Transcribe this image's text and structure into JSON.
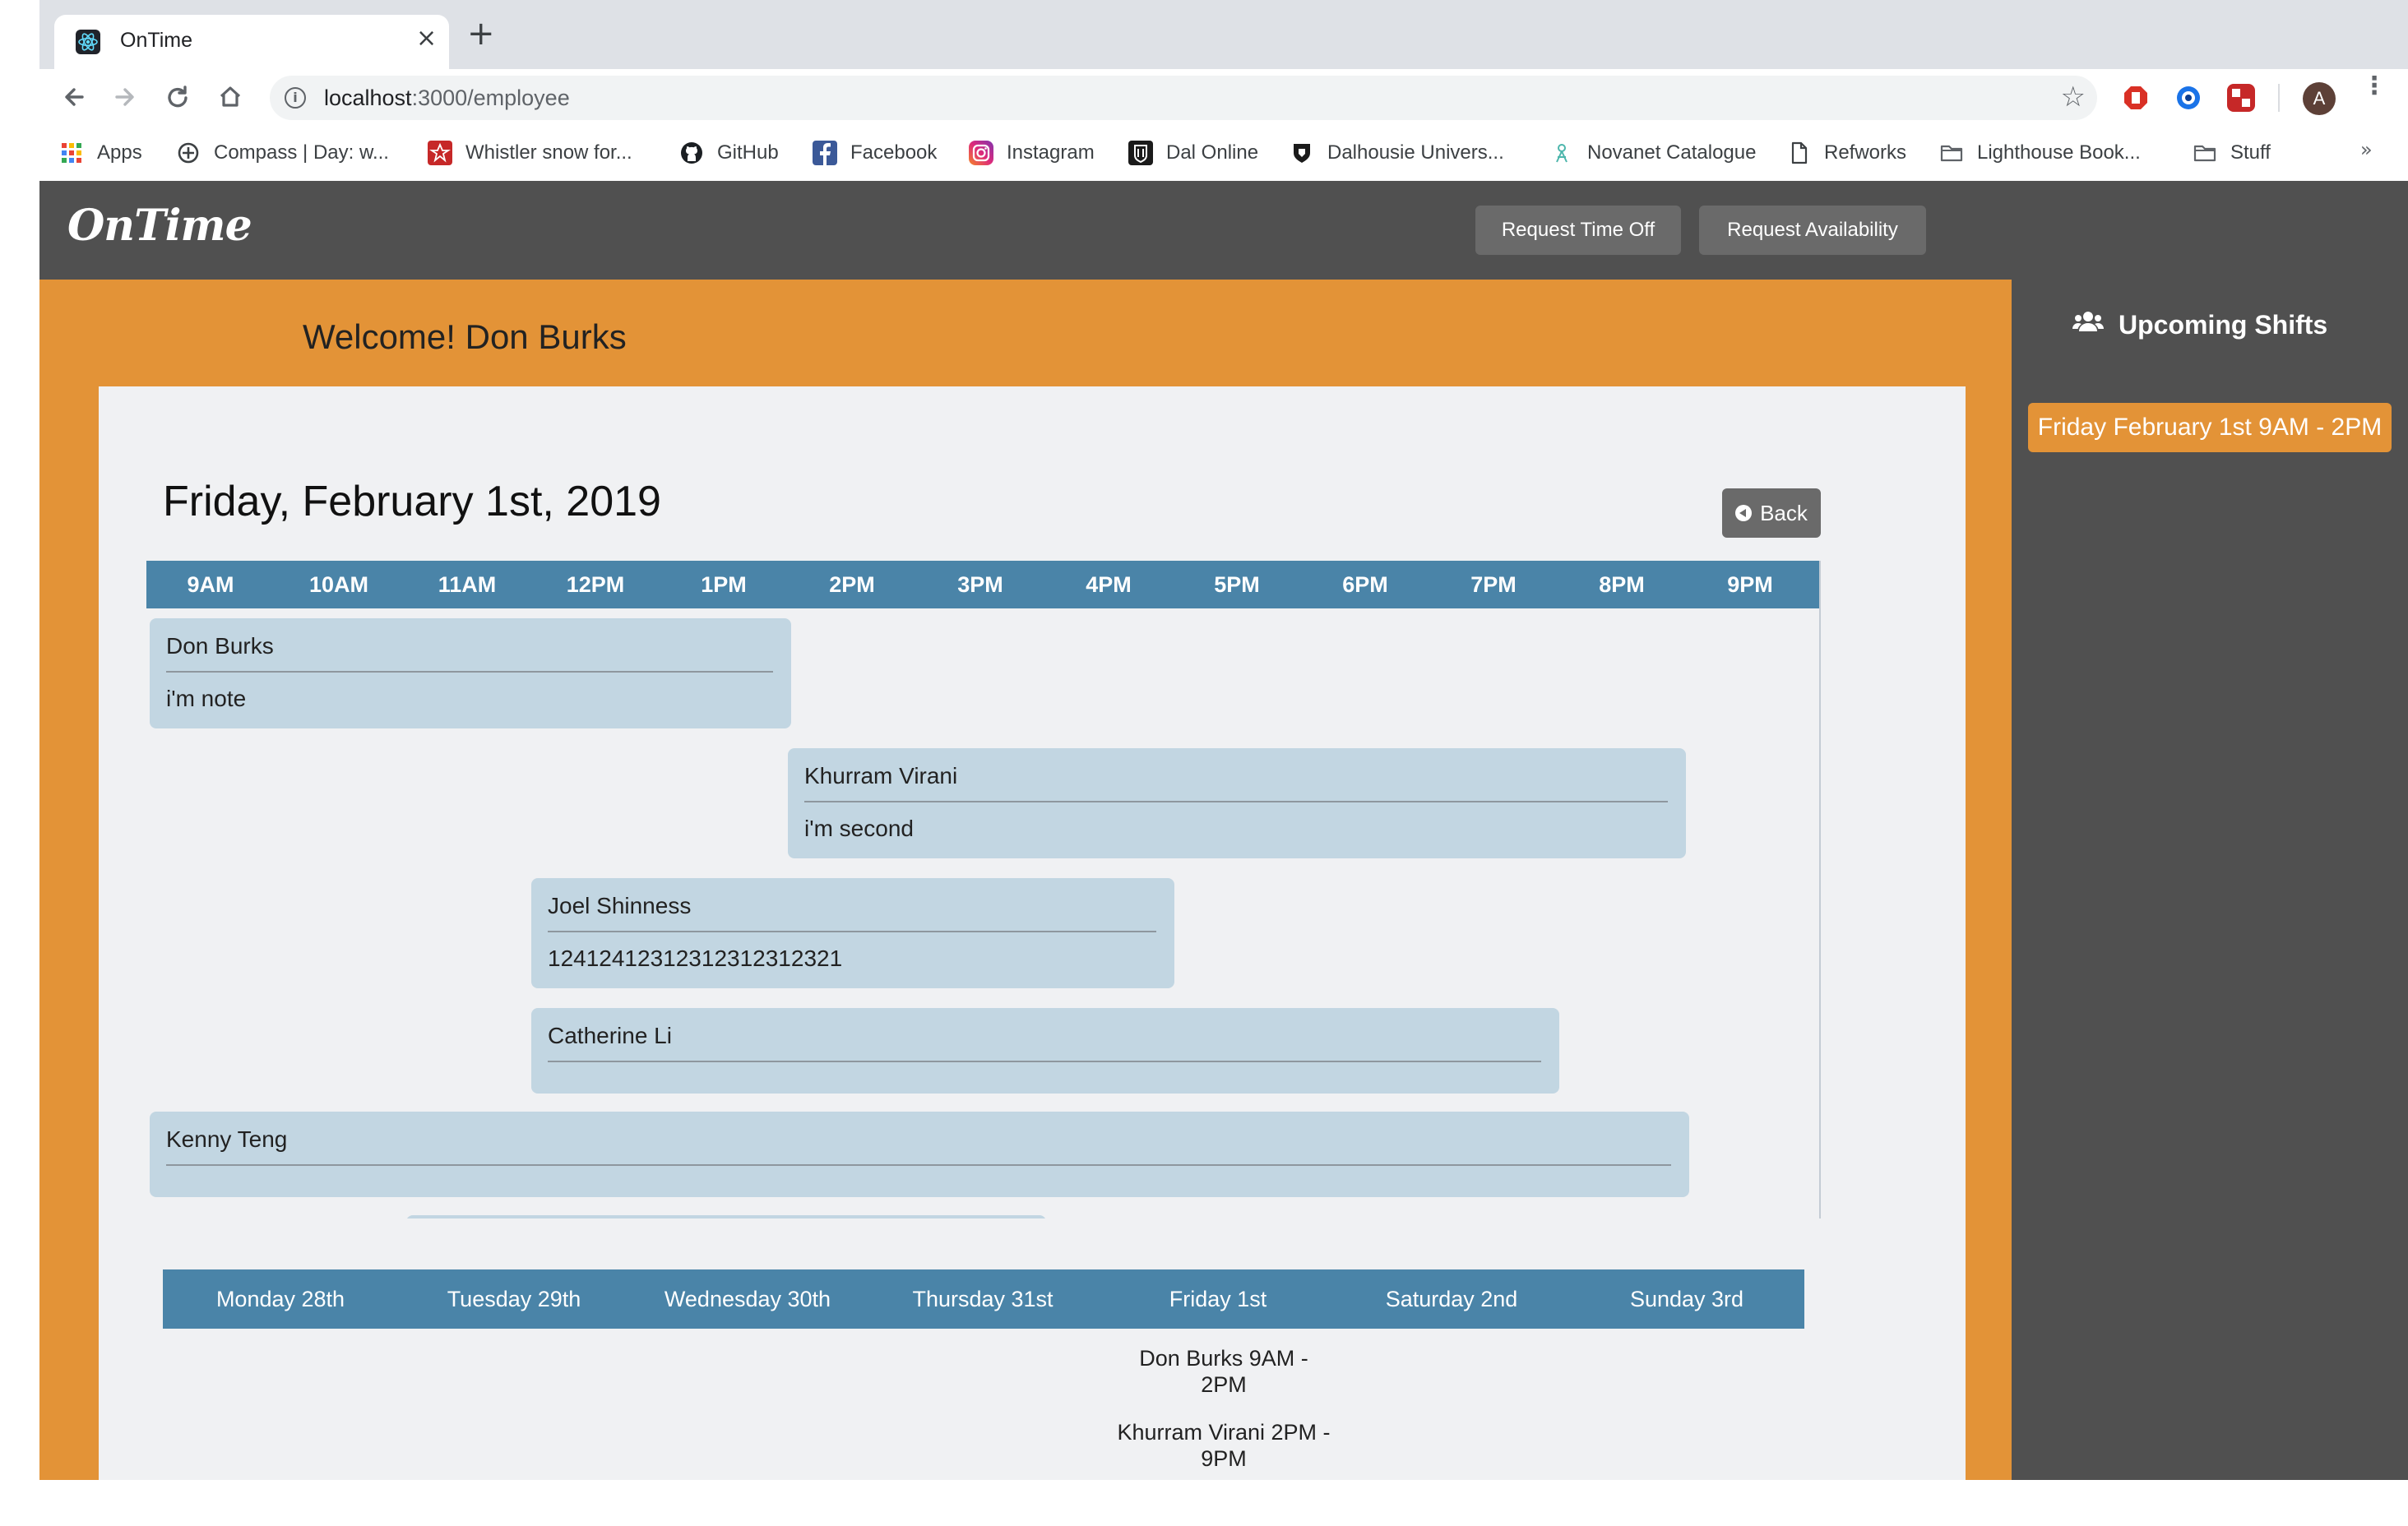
{
  "browser": {
    "tab_title": "OnTime",
    "tab_close": "×",
    "new_tab": "+",
    "url_host": "localhost",
    "url_path": ":3000/employee",
    "bookmarks": [
      {
        "label": "Apps",
        "icon": "apps-grid-icon"
      },
      {
        "label": "Compass | Day: w...",
        "icon": "compass-icon"
      },
      {
        "label": "Whistler snow for...",
        "icon": "whistler-icon"
      },
      {
        "label": "GitHub",
        "icon": "github-icon"
      },
      {
        "label": "Facebook",
        "icon": "facebook-icon"
      },
      {
        "label": "Instagram",
        "icon": "instagram-icon"
      },
      {
        "label": "Dal Online",
        "icon": "dal-online-icon"
      },
      {
        "label": "Dalhousie Univers...",
        "icon": "dalhousie-shield-icon"
      },
      {
        "label": "Novanet Catalogue",
        "icon": "novanet-icon"
      },
      {
        "label": "Refworks",
        "icon": "document-icon"
      },
      {
        "label": "Lighthouse Book...",
        "icon": "folder-icon"
      },
      {
        "label": "Stuff",
        "icon": "folder-icon"
      }
    ],
    "bookmarks_more": "»",
    "profile_initial": "A"
  },
  "app": {
    "logo": "OnTime",
    "header_buttons": [
      "Request Time Off",
      "Request Availability"
    ],
    "welcome": "Welcome! Don Burks",
    "day_title": "Friday, February 1st, 2019",
    "back_label": "Back",
    "hours": [
      "9AM",
      "10AM",
      "11AM",
      "12PM",
      "1PM",
      "2PM",
      "3PM",
      "4PM",
      "5PM",
      "6PM",
      "7PM",
      "8PM",
      "9PM"
    ],
    "shifts": [
      {
        "name": "Don Burks",
        "note": "i'm note"
      },
      {
        "name": "Khurram Virani",
        "note": "i'm second"
      },
      {
        "name": "Joel Shinness",
        "note": "12412412312312312312321"
      },
      {
        "name": "Catherine Li",
        "note": ""
      },
      {
        "name": "Kenny Teng",
        "note": ""
      }
    ],
    "week_days": [
      "Monday 28th",
      "Tuesday 29th",
      "Wednesday 30th",
      "Thursday 31st",
      "Friday 1st",
      "Saturday 2nd",
      "Sunday 3rd"
    ],
    "week_entries": [
      {
        "line1": "Don Burks 9AM -",
        "line2": "2PM"
      },
      {
        "line1": "Khurram Virani 2PM -",
        "line2": "9PM"
      }
    ],
    "sidebar_title": "Upcoming Shifts",
    "upcoming_shifts": [
      "Friday February 1st 9AM - 2PM"
    ]
  },
  "colors": {
    "header_gray": "#505050",
    "accent_orange": "#e39337",
    "timeline_blue": "#4a84a8",
    "shift_block": "#c2d6e2",
    "button_gray": "#6a6a6a"
  }
}
